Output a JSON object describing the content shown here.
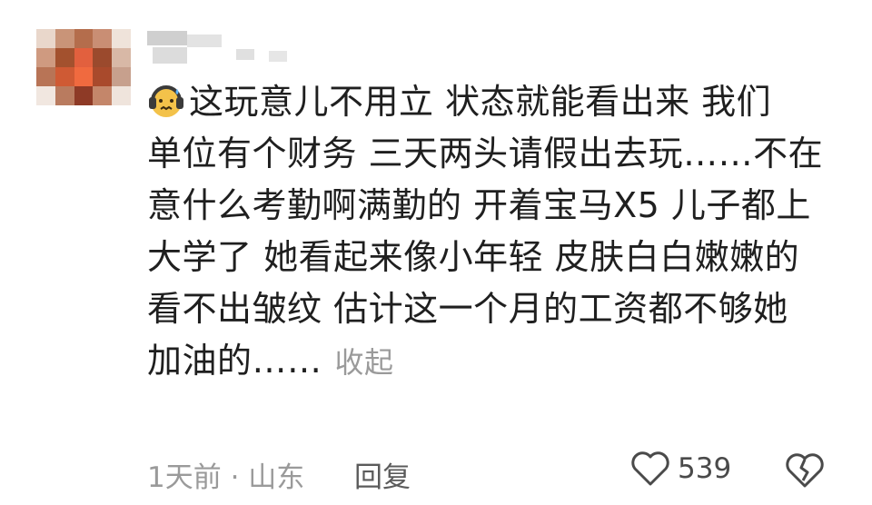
{
  "comment": {
    "lines": [
      "这玩意儿不用立 状态就能看出来 我们",
      "单位有个财务 三天两头请假出去玩……不在",
      "意什么考勤啊满勤的 开着宝马X5 儿子都上",
      "大学了 她看起来像小年轻 皮肤白白嫩嫩的",
      "看不出皱纹 估计这一个月的工资都不够她",
      "加油的……"
    ],
    "collapse_label": "收起",
    "emoji": "headphones-sweat-emoji"
  },
  "footer": {
    "meta": "1天前 · 山东",
    "reply_label": "回复",
    "like_count": "539",
    "like_icon": "heart-outline-icon",
    "dislike_icon": "broken-heart-icon"
  },
  "colors": {
    "text": "#1f1f1f",
    "muted": "#9a9a9a",
    "avatar": [
      "#a35a2b",
      "#e3613c",
      "#c98f72",
      "#efe1d6",
      "#8e3a26"
    ]
  }
}
